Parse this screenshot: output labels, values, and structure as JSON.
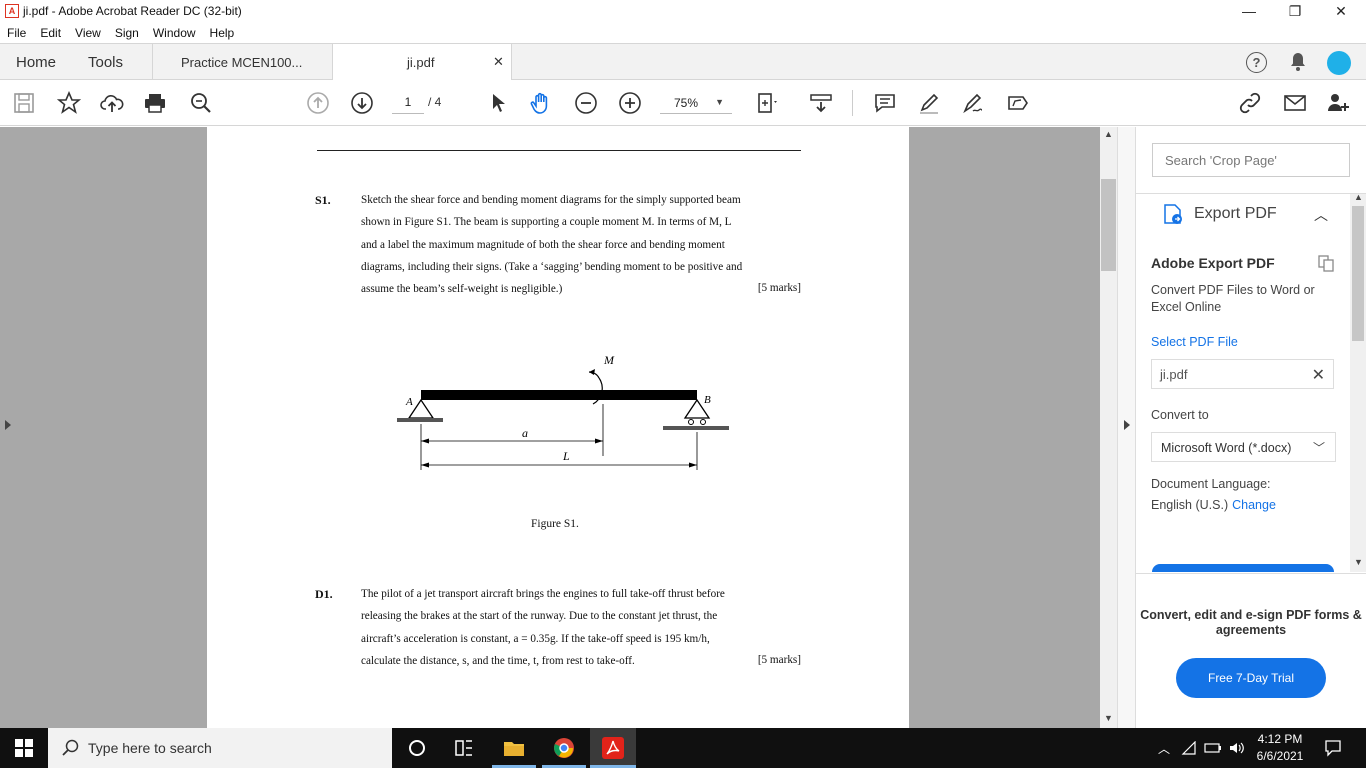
{
  "window": {
    "title": "ji.pdf - Adobe Acrobat Reader DC (32-bit)",
    "minimize": "—",
    "restore": "❐",
    "close": "✕"
  },
  "menu": [
    "File",
    "Edit",
    "View",
    "Sign",
    "Window",
    "Help"
  ],
  "tabs": {
    "home": "Home",
    "tools": "Tools",
    "doc1": "Practice MCEN100...",
    "doc2": "ji.pdf",
    "close": "✕"
  },
  "toolbar": {
    "page_current": "1",
    "page_total": "/ 4",
    "zoom": "75%"
  },
  "document": {
    "s1": {
      "num": "S1.",
      "lines": [
        "Sketch the shear force and bending moment diagrams for the simply supported beam",
        "shown in Figure S1.  The beam is supporting a couple moment M.  In terms of M, L",
        "and a label the maximum magnitude of both the shear force and bending moment",
        "diagrams, including their signs. (Take a ‘sagging’ bending moment to be positive and",
        "assume the beam’s self-weight is negligible.)"
      ],
      "marks": "[5 marks]"
    },
    "figure": {
      "label_M": "M",
      "label_A": "A",
      "label_B": "B",
      "label_a": "a",
      "label_L": "L",
      "caption": "Figure S1."
    },
    "d1": {
      "num": "D1.",
      "lines": [
        "The pilot of a jet transport aircraft brings the engines to full take-off thrust before",
        "releasing the brakes at the start of the runway.  Due to the constant jet thrust, the",
        "aircraft’s acceleration is constant, a = 0.35g.  If the take-off speed is 195 km/h,",
        "calculate the distance, s, and the time, t, from rest to take-off."
      ],
      "marks": "[5 marks]"
    }
  },
  "panel": {
    "search_placeholder": "Search 'Crop Page'",
    "export_header": "Export PDF",
    "ae_title": "Adobe Export PDF",
    "ae_desc": "Convert PDF Files to Word or Excel Online",
    "select_file": "Select PDF File",
    "file_name": "ji.pdf",
    "convert_to": "Convert to",
    "format": "Microsoft Word (*.docx)",
    "doc_lang_label": "Document Language:",
    "doc_lang": "English (U.S.)",
    "change": "Change",
    "promo": "Convert, edit and e-sign PDF forms & agreements",
    "trial": "Free 7-Day Trial"
  },
  "taskbar": {
    "search": "Type here to search",
    "time": "4:12 PM",
    "date": "6/6/2021"
  },
  "colors": {
    "accent": "#1473e6",
    "avatar": "#1fb0e8",
    "doc_bg": "#a8a8a8"
  }
}
